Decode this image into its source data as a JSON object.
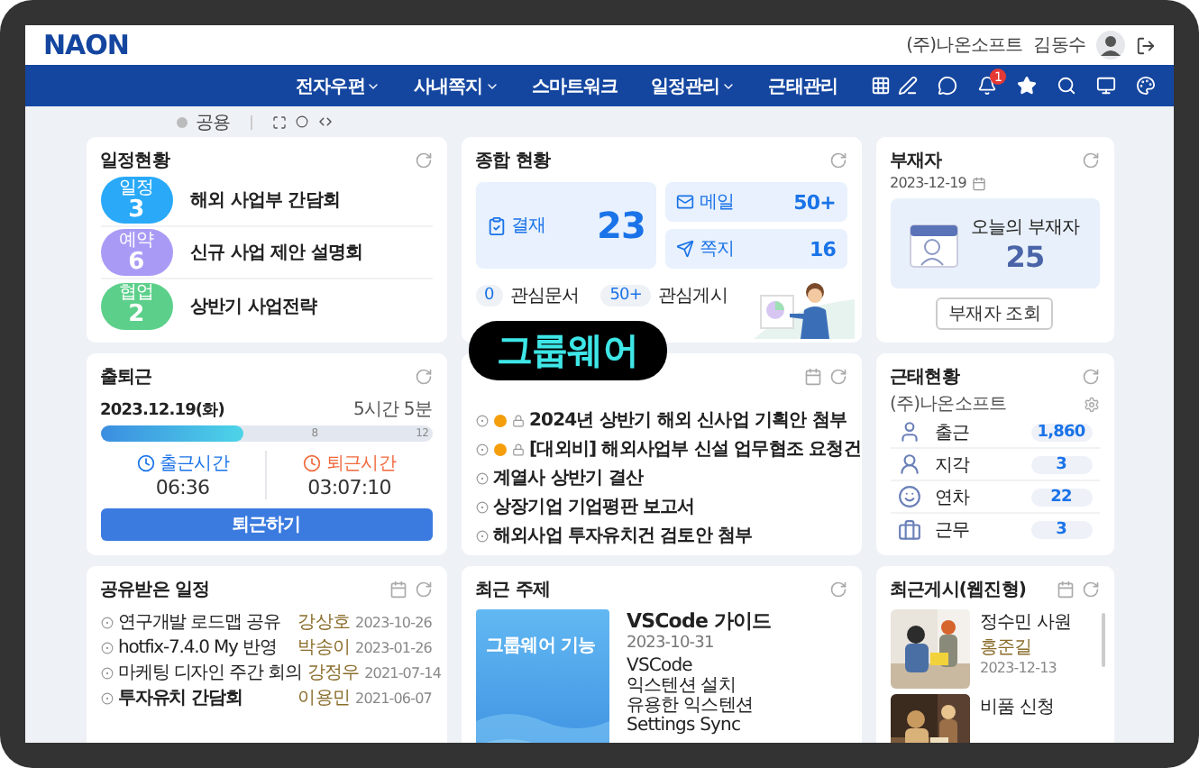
{
  "header": {
    "logo": "NAON",
    "company": "(주)나온소프트",
    "user": "김동수"
  },
  "nav": {
    "items": [
      {
        "label": "전자우편",
        "dropdown": true
      },
      {
        "label": "사내쪽지",
        "dropdown": true
      },
      {
        "label": "스마트워크",
        "dropdown": false
      },
      {
        "label": "일정관리",
        "dropdown": true
      },
      {
        "label": "근태관리",
        "dropdown": false
      }
    ],
    "badge": "1"
  },
  "toolbar": {
    "option": {
      "label": "공용",
      "selected": false
    }
  },
  "schedule": {
    "title": "일정현황",
    "items": [
      {
        "tag": "일정",
        "count": "3",
        "title": "해외 사업부 간담회",
        "color": "#29a9f8"
      },
      {
        "tag": "예약",
        "count": "6",
        "title": "신규 사업 제안 설명회",
        "color": "#a99bf5"
      },
      {
        "tag": "협업",
        "count": "2",
        "title": "상반기 사업전략",
        "color": "#5cd08a"
      }
    ]
  },
  "summary": {
    "title": "종합 현황",
    "approval": {
      "label": "결재",
      "count": "23"
    },
    "mail": {
      "label": "메일",
      "count": "50+"
    },
    "memo": {
      "label": "쪽지",
      "count": "16"
    },
    "watch": [
      {
        "count": "0",
        "label": "관심문서"
      },
      {
        "count": "50+",
        "label": "관심게시"
      }
    ]
  },
  "absence": {
    "title": "부재자",
    "date": "2023-12-19",
    "caption": "오늘의 부재자",
    "count": "25",
    "button": "부재자 조회"
  },
  "attendance": {
    "title": "출퇴근",
    "date": "2023.12.19(화)",
    "duration": "5시간 5분",
    "level": 0.43,
    "ticks": [
      "8",
      "12"
    ],
    "clock_in": {
      "label": "출근시간",
      "time": "06:36"
    },
    "clock_out": {
      "label": "퇴근시간",
      "time": "03:07:10"
    },
    "button": "퇴근하기"
  },
  "board": {
    "items": [
      {
        "title": "2024년 상반기 해외 신사업 기획안 첨부",
        "flagged": true
      },
      {
        "title": "[대외비] 해외사업부 신설 업무협조 요청건",
        "flagged": true
      },
      {
        "title": "계열사 상반기 결산",
        "flagged": false
      },
      {
        "title": "상장기업 기업평판 보고서",
        "flagged": false
      },
      {
        "title": "해외사업 투자유치건 검토안 첨부",
        "flagged": false
      }
    ]
  },
  "status": {
    "title": "근태현황",
    "company": "(주)나온소프트",
    "rows": [
      {
        "kind": "clock-in",
        "label": "출근",
        "count": "1,860"
      },
      {
        "kind": "late",
        "label": "지각",
        "count": "3"
      },
      {
        "kind": "leave",
        "label": "연차",
        "count": "22"
      },
      {
        "kind": "work",
        "label": "근무",
        "count": "3"
      }
    ]
  },
  "shared": {
    "title": "공유받은 일정",
    "items": [
      {
        "title": "연구개발 로드맵 공유",
        "owner": "강상호",
        "date": "2023-10-26",
        "unread": false
      },
      {
        "title": "hotfix-7.4.0 My 반영",
        "owner": "박송이",
        "date": "2023-01-26",
        "unread": false
      },
      {
        "title": "마케팅 디자인 주간 회의",
        "owner": "강정우",
        "date": "2021-07-14",
        "unread": false
      },
      {
        "title": "투자유치 간담회",
        "owner": "이용민",
        "date": "2021-06-07",
        "unread": true
      }
    ]
  },
  "topic": {
    "title": "최근 주제",
    "thumbnail": "그룹웨어 기능",
    "heading": "VSCode 가이드",
    "date": "2023-10-31",
    "lines": [
      "VSCode",
      "익스텐션 설치",
      "유용한 익스텐션",
      "Settings Sync"
    ]
  },
  "gallery": {
    "title": "최근게시(웹진형)",
    "posts": [
      {
        "title": "정수민 사원",
        "author": "홍준길",
        "date": "2023-12-13"
      },
      {
        "title": "비품 신청"
      }
    ]
  },
  "overlay": {
    "label": "그룹웨어"
  }
}
